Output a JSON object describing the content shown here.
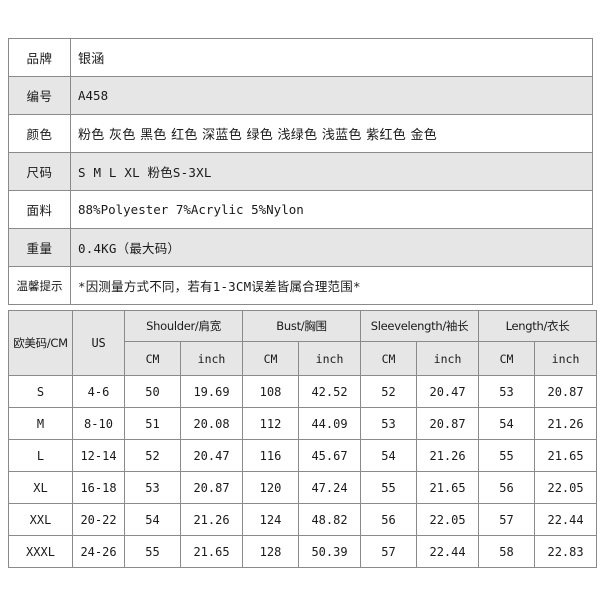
{
  "colors": {
    "page_background": "#ffffff",
    "border": "#8a8a8a",
    "row_shade": "#e6e6e6",
    "text": "#1a1a1a"
  },
  "info_table": {
    "rows": [
      {
        "label": "品牌",
        "value": "银涵",
        "value_style": "cjk",
        "shaded": false
      },
      {
        "label": "编号",
        "value": "A458",
        "value_style": "mono",
        "shaded": true
      },
      {
        "label": "颜色",
        "value": "粉色 灰色 黑色 红色 深蓝色 绿色 浅绿色 浅蓝色 紫红色 金色",
        "value_style": "cjk",
        "shaded": false
      },
      {
        "label": "尺码",
        "value": "S M L XL  粉色S-3XL",
        "value_style": "mixed",
        "shaded": true
      },
      {
        "label": "面料",
        "value": "88%Polyester  7%Acrylic  5%Nylon",
        "value_style": "mono",
        "shaded": false
      },
      {
        "label": "重量",
        "value": "0.4KG（最大码）",
        "value_style": "mixed",
        "shaded": true
      },
      {
        "label": "温馨提示",
        "value": "*因测量方式不同，若有1-3CM误差皆属合理范围*",
        "value_style": "mixed",
        "shaded": false
      }
    ]
  },
  "size_table": {
    "group_headers": [
      {
        "label": "欧美码/CM",
        "style": "grp-cjk",
        "colspan": 1,
        "rowspan": 2
      },
      {
        "label": "US",
        "style": "grp",
        "colspan": 1,
        "rowspan": 2
      },
      {
        "label": "Shoulder/肩宽",
        "style": "grp-cjk",
        "colspan": 2,
        "rowspan": 1
      },
      {
        "label": "Bust/胸围",
        "style": "grp-cjk",
        "colspan": 2,
        "rowspan": 1
      },
      {
        "label": "Sleevelength/袖长",
        "style": "grp-cjk",
        "colspan": 2,
        "rowspan": 1
      },
      {
        "label": "Length/衣长",
        "style": "grp-cjk",
        "colspan": 2,
        "rowspan": 1
      }
    ],
    "unit_headers": [
      "CM",
      "inch",
      "CM",
      "inch",
      "CM",
      "inch",
      "CM",
      "inch"
    ],
    "rows": [
      {
        "size": "S",
        "us": "4-6",
        "shoulder_cm": "50",
        "shoulder_in": "19.69",
        "bust_cm": "108",
        "bust_in": "42.52",
        "sleeve_cm": "52",
        "sleeve_in": "20.47",
        "length_cm": "53",
        "length_in": "20.87"
      },
      {
        "size": "M",
        "us": "8-10",
        "shoulder_cm": "51",
        "shoulder_in": "20.08",
        "bust_cm": "112",
        "bust_in": "44.09",
        "sleeve_cm": "53",
        "sleeve_in": "20.87",
        "length_cm": "54",
        "length_in": "21.26"
      },
      {
        "size": "L",
        "us": "12-14",
        "shoulder_cm": "52",
        "shoulder_in": "20.47",
        "bust_cm": "116",
        "bust_in": "45.67",
        "sleeve_cm": "54",
        "sleeve_in": "21.26",
        "length_cm": "55",
        "length_in": "21.65"
      },
      {
        "size": "XL",
        "us": "16-18",
        "shoulder_cm": "53",
        "shoulder_in": "20.87",
        "bust_cm": "120",
        "bust_in": "47.24",
        "sleeve_cm": "55",
        "sleeve_in": "21.65",
        "length_cm": "56",
        "length_in": "22.05"
      },
      {
        "size": "XXL",
        "us": "20-22",
        "shoulder_cm": "54",
        "shoulder_in": "21.26",
        "bust_cm": "124",
        "bust_in": "48.82",
        "sleeve_cm": "56",
        "sleeve_in": "22.05",
        "length_cm": "57",
        "length_in": "22.44"
      },
      {
        "size": "XXXL",
        "us": "24-26",
        "shoulder_cm": "55",
        "shoulder_in": "21.65",
        "bust_cm": "128",
        "bust_in": "50.39",
        "sleeve_cm": "57",
        "sleeve_in": "22.44",
        "length_cm": "58",
        "length_in": "22.83"
      }
    ]
  }
}
